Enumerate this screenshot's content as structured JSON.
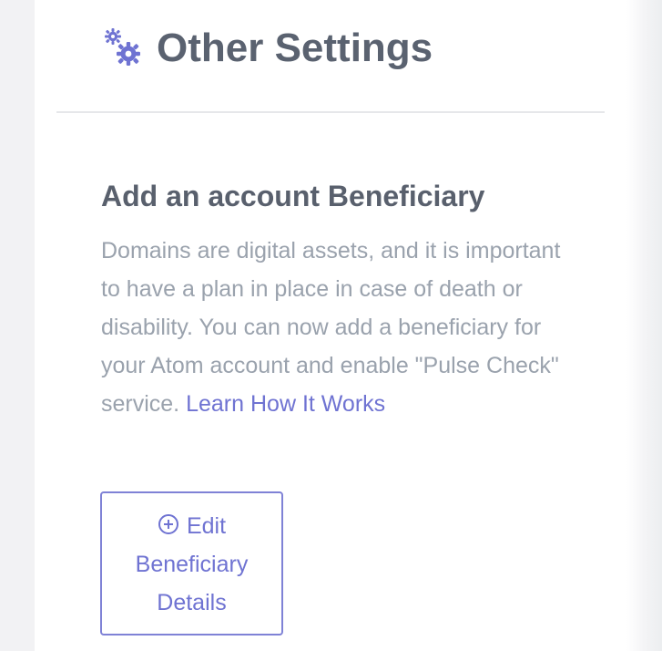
{
  "header": {
    "icon": "gears-icon",
    "title": "Other Settings"
  },
  "section": {
    "title": "Add an account Beneficiary",
    "description": "Domains are digital assets, and it is important to have a plan in place in case of death or disability. You can now add a beneficiary for your Atom account and enable \"Pulse Check\" service. ",
    "link_label": "Learn How It Works"
  },
  "edit_button": {
    "icon": "plus-circle-icon",
    "label_line1": "Edit",
    "label_line2": "Beneficiary",
    "label_line3": "Details"
  },
  "colors": {
    "accent": "#6f73d2",
    "title": "#5a6270",
    "body_text": "#9aa2ad"
  }
}
